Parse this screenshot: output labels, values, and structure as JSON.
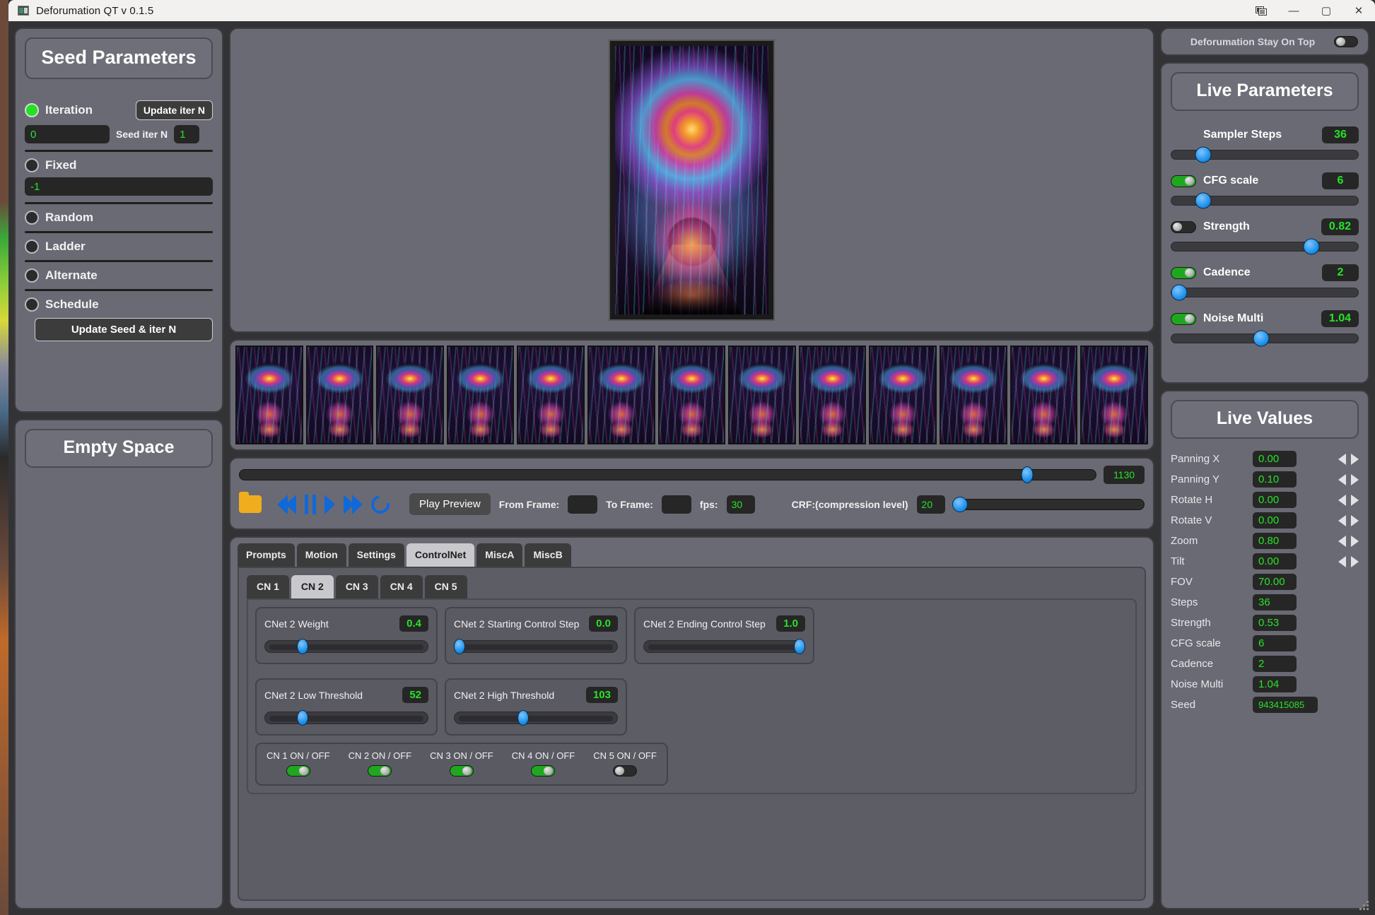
{
  "window": {
    "title": "Deforumation QT v 0.1.5",
    "app_icon": "app-icon",
    "controls": {
      "layout": "▯",
      "minimize": "—",
      "maximize": "▢",
      "close": "✕"
    }
  },
  "seed_panel": {
    "title": "Seed Parameters",
    "modes": [
      {
        "label": "Iteration",
        "selected": true
      },
      {
        "label": "Fixed",
        "selected": false
      },
      {
        "label": "Random",
        "selected": false
      },
      {
        "label": "Ladder",
        "selected": false
      },
      {
        "label": "Alternate",
        "selected": false
      },
      {
        "label": "Schedule",
        "selected": false
      }
    ],
    "update_iter_button": "Update iter N",
    "iteration_value": "0",
    "seed_iter_n_label": "Seed iter N",
    "seed_iter_n_value": "1",
    "fixed_value": "-1",
    "update_seed_button": "Update Seed & iter N"
  },
  "empty_panel": {
    "title": "Empty Space"
  },
  "transport": {
    "frame_slider_value": "1130",
    "frame_slider_percent": 92,
    "folder_icon": "folder-icon",
    "buttons": [
      "skip-back-icon",
      "pause-icon",
      "play-icon",
      "skip-forward-icon",
      "loop-icon"
    ],
    "play_preview_label": "Play Preview",
    "from_frame_label": "From Frame:",
    "from_frame_value": "",
    "to_frame_label": "To Frame:",
    "to_frame_value": "",
    "fps_label": "fps:",
    "fps_value": "30",
    "crf_label": "CRF:(compression level)",
    "crf_value": "20",
    "crf_percent": 3
  },
  "tabs": {
    "items": [
      "Prompts",
      "Motion",
      "Settings",
      "ControlNet",
      "MiscA",
      "MiscB"
    ],
    "active": "ControlNet"
  },
  "controlnet": {
    "subtabs": [
      "CN 1",
      "CN 2",
      "CN 3",
      "CN 4",
      "CN 5"
    ],
    "active_subtab": "CN 2",
    "sliders": [
      {
        "label": "CNet 2 Weight",
        "value": "0.4",
        "percent": 23
      },
      {
        "label": "CNet 2 Starting Control Step",
        "value": "0.0",
        "percent": 3
      },
      {
        "label": "CNet 2 Ending Control Step",
        "value": "1.0",
        "percent": 97
      },
      {
        "label": "CNet 2 Low Threshold",
        "value": "52",
        "percent": 23
      },
      {
        "label": "CNet 2 High Threshold",
        "value": "103",
        "percent": 42
      }
    ],
    "toggles": [
      {
        "label": "CN 1 ON / OFF",
        "on": true
      },
      {
        "label": "CN 2 ON / OFF",
        "on": true
      },
      {
        "label": "CN 3 ON / OFF",
        "on": true
      },
      {
        "label": "CN 4 ON / OFF",
        "on": true
      },
      {
        "label": "CN 5 ON / OFF",
        "on": false
      }
    ]
  },
  "stay_on_top": {
    "label": "Deforumation Stay On Top",
    "on": false
  },
  "live_parameters": {
    "title": "Live Parameters",
    "rows": [
      {
        "name": "Sampler Steps",
        "value": "36",
        "percent": 17,
        "has_toggle": false,
        "toggle_on": false
      },
      {
        "name": "CFG scale",
        "value": "6",
        "percent": 17,
        "has_toggle": true,
        "toggle_on": true
      },
      {
        "name": "Strength",
        "value": "0.82",
        "percent": 75,
        "has_toggle": true,
        "toggle_on": false
      },
      {
        "name": "Cadence",
        "value": "2",
        "percent": 4,
        "has_toggle": true,
        "toggle_on": true
      },
      {
        "name": "Noise Multi",
        "value": "1.04",
        "percent": 48,
        "has_toggle": true,
        "toggle_on": true
      }
    ]
  },
  "live_values": {
    "title": "Live Values",
    "rows": [
      {
        "name": "Panning X",
        "value": "0.00",
        "arrows": true,
        "wide": false
      },
      {
        "name": "Panning Y",
        "value": "0.10",
        "arrows": true,
        "wide": false
      },
      {
        "name": "Rotate H",
        "value": "0.00",
        "arrows": true,
        "wide": false
      },
      {
        "name": "Rotate V",
        "value": "0.00",
        "arrows": true,
        "wide": false
      },
      {
        "name": "Zoom",
        "value": "0.80",
        "arrows": true,
        "wide": false
      },
      {
        "name": "Tilt",
        "value": "0.00",
        "arrows": true,
        "wide": false
      },
      {
        "name": "FOV",
        "value": "70.00",
        "arrows": false,
        "wide": false
      },
      {
        "name": "Steps",
        "value": "36",
        "arrows": false,
        "wide": false
      },
      {
        "name": "Strength",
        "value": "0.53",
        "arrows": false,
        "wide": false
      },
      {
        "name": "CFG scale",
        "value": "6",
        "arrows": false,
        "wide": false
      },
      {
        "name": "Cadence",
        "value": "2",
        "arrows": false,
        "wide": false
      },
      {
        "name": "Noise Multi",
        "value": "1.04",
        "arrows": false,
        "wide": false
      },
      {
        "name": "Seed",
        "value": "943415085",
        "arrows": false,
        "wide": true
      }
    ]
  },
  "filmstrip": {
    "thumb_count": 13
  },
  "colors": {
    "panel_bg": "#6a6a74",
    "value_green": "#27e327",
    "toggle_on": "#1fa81f",
    "slider_blue": "#1a8fe8",
    "accent_folder": "#f0ad1e"
  }
}
